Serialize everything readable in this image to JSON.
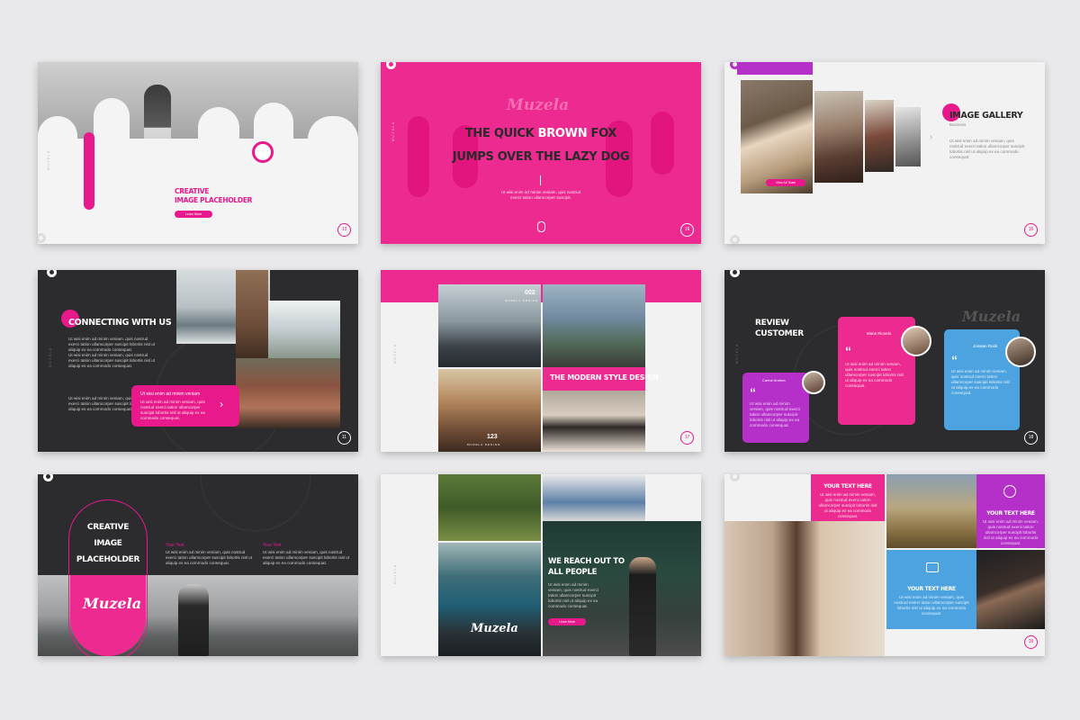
{
  "colors": {
    "pink": "#e8198b",
    "purple": "#b530c8",
    "blue": "#4da3e0",
    "dark": "#2c2c2e"
  },
  "brand": "Muzela",
  "vertical_label": "MUZELA",
  "placeholder_body": "Ut wisi enim ad minim veniam, quis nostrud exerci tation ullamcorper suscipit lobortis nisl ut aliquip ex ea commodo consequat.",
  "slides": [
    {
      "title_line1": "CREATIVE",
      "title_line2": "IMAGE PLACEHOLDER",
      "button": "Learn More",
      "number": "13"
    },
    {
      "line1_a": "THE QUICK ",
      "line1_b": "BROWN",
      "line1_c": " FOX",
      "line2": "JUMPS OVER THE LAZY DOG",
      "body": "Ut wisi enim ad minim veniam, quis nostrud exerci tation ullamcorper suscipit.",
      "number": "16"
    },
    {
      "title": "IMAGE GALLERY",
      "subtitle": "Business",
      "button": "View All Team",
      "number": "15",
      "arrow": "›"
    },
    {
      "title": "CONNECTING WITH US",
      "box_text": "Ut wisi enim ad minim veniam",
      "arrow": "›",
      "number": "11"
    },
    {
      "num_top": "002",
      "num_bottom": "123",
      "tag": "MUZELA DESIGN",
      "title": "THE MODERN STYLE DESIGN",
      "number": "17"
    },
    {
      "title_line1": "REVIEW",
      "title_line2": "CUSTOMER",
      "cards": [
        {
          "name": "Carine Andrea"
        },
        {
          "name": "Maria Ricardo"
        },
        {
          "name": "Jonatan Rodri"
        }
      ],
      "quote": "“",
      "number": "18"
    },
    {
      "title_line1": "CREATIVE",
      "title_line2": "IMAGE",
      "title_line3": "PLACEHOLDER",
      "col_title_1": "Your Text",
      "col_title_2": "Your Text",
      "number": ""
    },
    {
      "title_line1": "WE REACH OUT TO",
      "title_line2": "ALL PEOPLE",
      "button": "Learn More",
      "number": ""
    },
    {
      "box_title_1": "YOUR TEXT HERE",
      "box_title_2": "YOUR TEXT HERE",
      "box_title_3": "YOUR TEXT HERE",
      "number": "19"
    }
  ]
}
